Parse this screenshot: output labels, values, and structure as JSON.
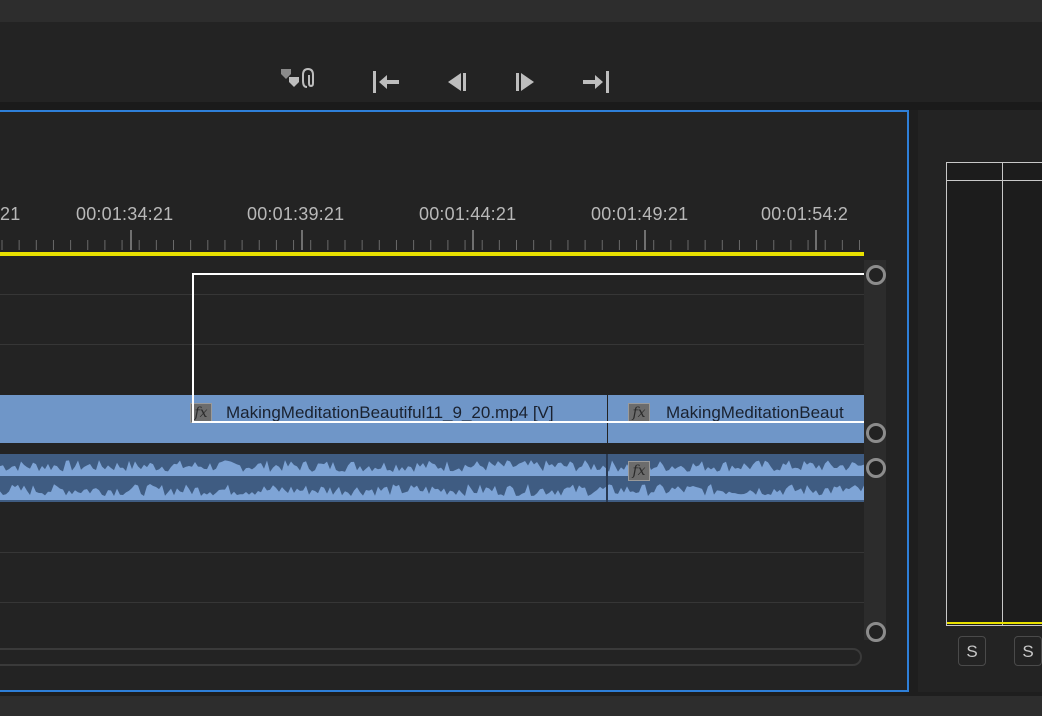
{
  "toolbar": {
    "buttons": [
      {
        "name": "add-marker-link-button",
        "icon": "marker-link-icon"
      },
      {
        "name": "go-to-in-button",
        "icon": "go-to-in-icon"
      },
      {
        "name": "step-back-button",
        "icon": "step-back-icon"
      },
      {
        "name": "step-forward-button",
        "icon": "step-forward-icon"
      },
      {
        "name": "go-to-out-button",
        "icon": "go-to-out-icon"
      }
    ]
  },
  "timeline": {
    "timecodes": [
      "21",
      "00:01:34:21",
      "00:01:39:21",
      "00:01:44:21",
      "00:01:49:21",
      "00:01:54:2"
    ],
    "video_clips": [
      {
        "label": "MakingMeditationBeautiful11_9_20.mp4 [V]",
        "fx": "fx"
      },
      {
        "label": "MakingMeditationBeaut",
        "fx": "fx"
      }
    ],
    "audio_fx": "fx"
  },
  "meters": {
    "solo_buttons": [
      "S",
      "S"
    ]
  },
  "colors": {
    "accent_border": "#2e7fd8",
    "playbar": "#e8e000",
    "clip": "#6f96c8",
    "background": "#232323"
  }
}
